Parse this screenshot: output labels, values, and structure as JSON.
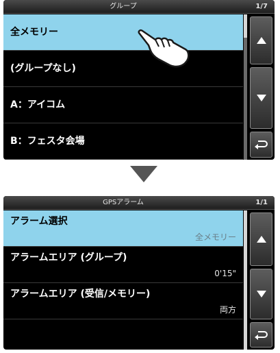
{
  "screen1": {
    "title": "グループ",
    "page": "1/7",
    "items": [
      {
        "label": "全メモリー"
      },
      {
        "label": "(グループなし)"
      },
      {
        "label": "A：アイコム"
      },
      {
        "label": "B：フェスタ会場"
      }
    ],
    "buttons": {
      "up": "up-arrow-icon",
      "down": "down-arrow-icon",
      "back": "return-icon"
    }
  },
  "screen2": {
    "title": "GPSアラーム",
    "page": "1/1",
    "items": [
      {
        "label": "アラーム選択",
        "value": "全メモリー"
      },
      {
        "label": "アラームエリア (グループ)",
        "value": "0'15\""
      },
      {
        "label": "アラームエリア (受信/メモリー)",
        "value": "両方"
      }
    ],
    "buttons": {
      "up": "up-arrow-icon",
      "down": "down-arrow-icon",
      "back": "return-icon"
    }
  },
  "colors": {
    "selected_row": "#8fd3ec",
    "screen_bg": "#000000",
    "arrow": "#555555"
  },
  "icons": {
    "pointer": "pointing-hand-icon",
    "transition": "down-triangle-icon"
  }
}
